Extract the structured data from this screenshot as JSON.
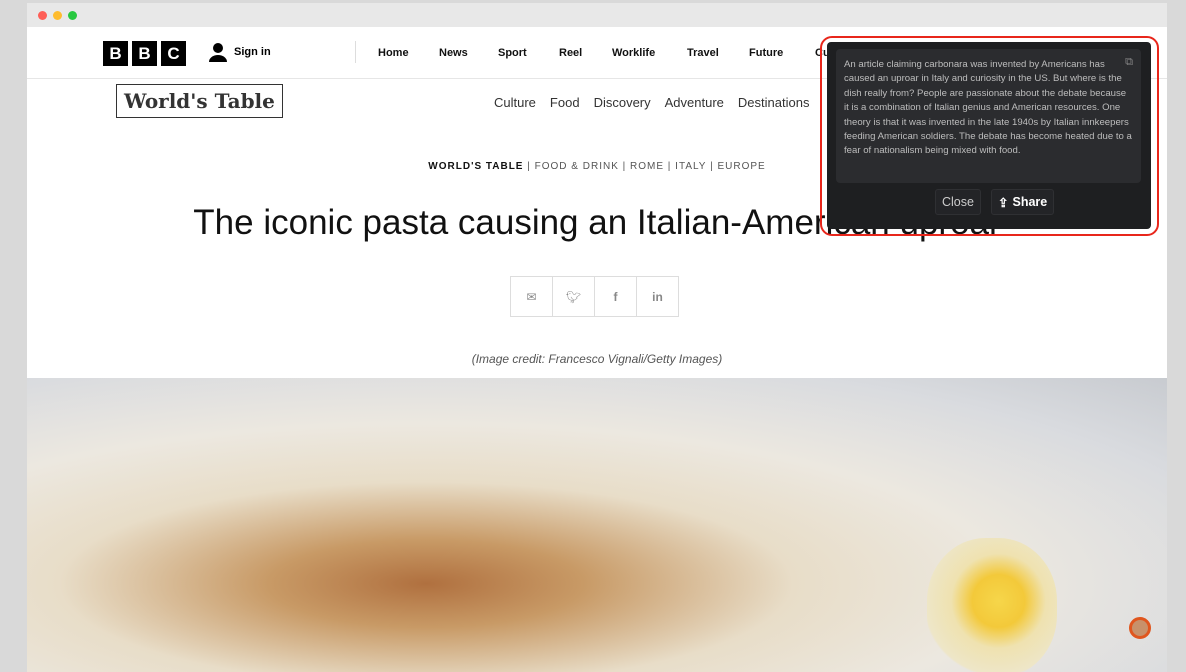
{
  "window": {
    "controls": [
      "close",
      "minimize",
      "maximize"
    ]
  },
  "topnav": {
    "logo": [
      "B",
      "B",
      "C"
    ],
    "signin": "Sign in",
    "items": [
      "Home",
      "News",
      "Sport",
      "Reel",
      "Worklife",
      "Travel",
      "Future",
      "Cu"
    ]
  },
  "subnav": {
    "logo": "World's Table",
    "links": [
      "Culture",
      "Food",
      "Discovery",
      "Adventure",
      "Destinations"
    ]
  },
  "article": {
    "breadcrumb_lead": "WORLD'S TABLE",
    "breadcrumb_rest": " | FOOD & DRINK | ROME | ITALY | EUROPE",
    "title": "The iconic pasta causing an Italian-American uproar",
    "share": [
      "email-icon",
      "twitter-icon",
      "facebook-icon",
      "linkedin-icon"
    ],
    "credit": "(Image credit: Francesco Vignali/Getty Images)"
  },
  "popup": {
    "summary": "An article claiming carbonara was invented by Americans has caused an uproar in Italy and curiosity in the US. But where is the dish really from? People are passionate about the debate because it is a combination of Italian genius and American resources. One theory is that it was invented in the late 1940s by Italian innkeepers feeding American soldiers. The debate has become heated due to a fear of nationalism being mixed with food.",
    "close": "Close",
    "share": "Share",
    "highlight_color": "#e8261b"
  }
}
